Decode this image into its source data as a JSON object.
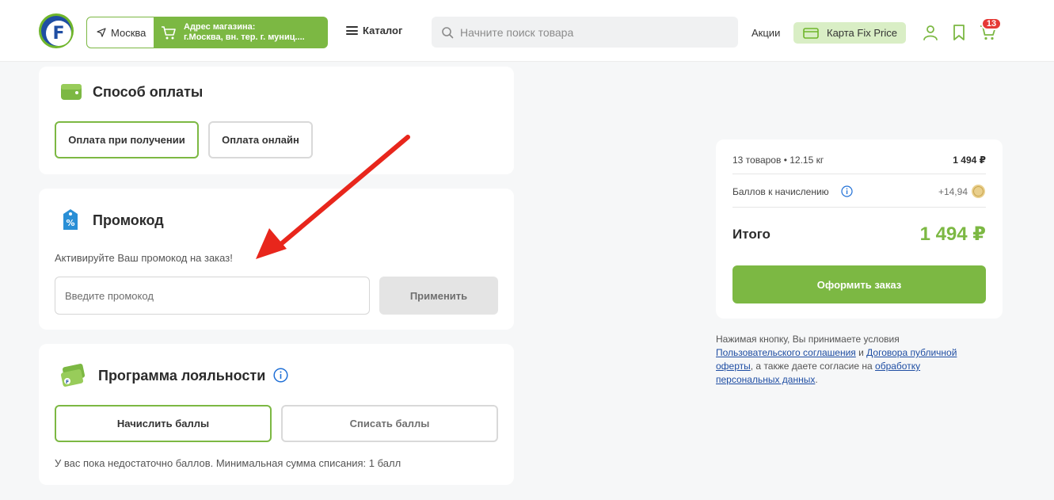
{
  "header": {
    "logo_letter": "F",
    "city": "Москва",
    "store_title": "Адрес магазина:",
    "store_address": "г.Москва, вн. тер. г. муниц....",
    "catalog_label": "Каталог",
    "search_placeholder": "Начните поиск товара",
    "promo_label": "Акции",
    "card_label": "Карта Fix Price",
    "cart_count": "13"
  },
  "payment": {
    "title": "Способ оплаты",
    "options": [
      "Оплата при получении",
      "Оплата онлайн"
    ],
    "selected": 0
  },
  "promocode": {
    "title": "Промокод",
    "hint": "Активируйте Ваш промокод на заказ!",
    "input_placeholder": "Введите промокод",
    "apply_label": "Применить"
  },
  "loyalty": {
    "title": "Программа лояльности",
    "options": [
      "Начислить баллы",
      "Списать баллы"
    ],
    "selected": 0,
    "note": "У вас пока недостаточно баллов. Минимальная сумма списания: 1 балл"
  },
  "summary": {
    "items_label": "13 товаров • 12.15 кг",
    "items_price": "1 494 ₽",
    "points_label": "Баллов к начислению",
    "points_value": "+14,94",
    "total_label": "Итого",
    "total_value": "1 494 ₽",
    "order_label": "Оформить заказ"
  },
  "legal": {
    "prefix": "Нажимая кнопку, Вы принимаете условия",
    "link1": "Пользовательского соглашения",
    "and": " и ",
    "link2": "Договора публичной оферты",
    "middle": ", а также даете согласие на ",
    "link3": "обработку персональных данных",
    "suffix": "."
  },
  "colors": {
    "brand_green": "#7cb843",
    "brand_blue": "#1f4ea3",
    "badge_red": "#e53935",
    "arrow_red": "#e8261c"
  }
}
